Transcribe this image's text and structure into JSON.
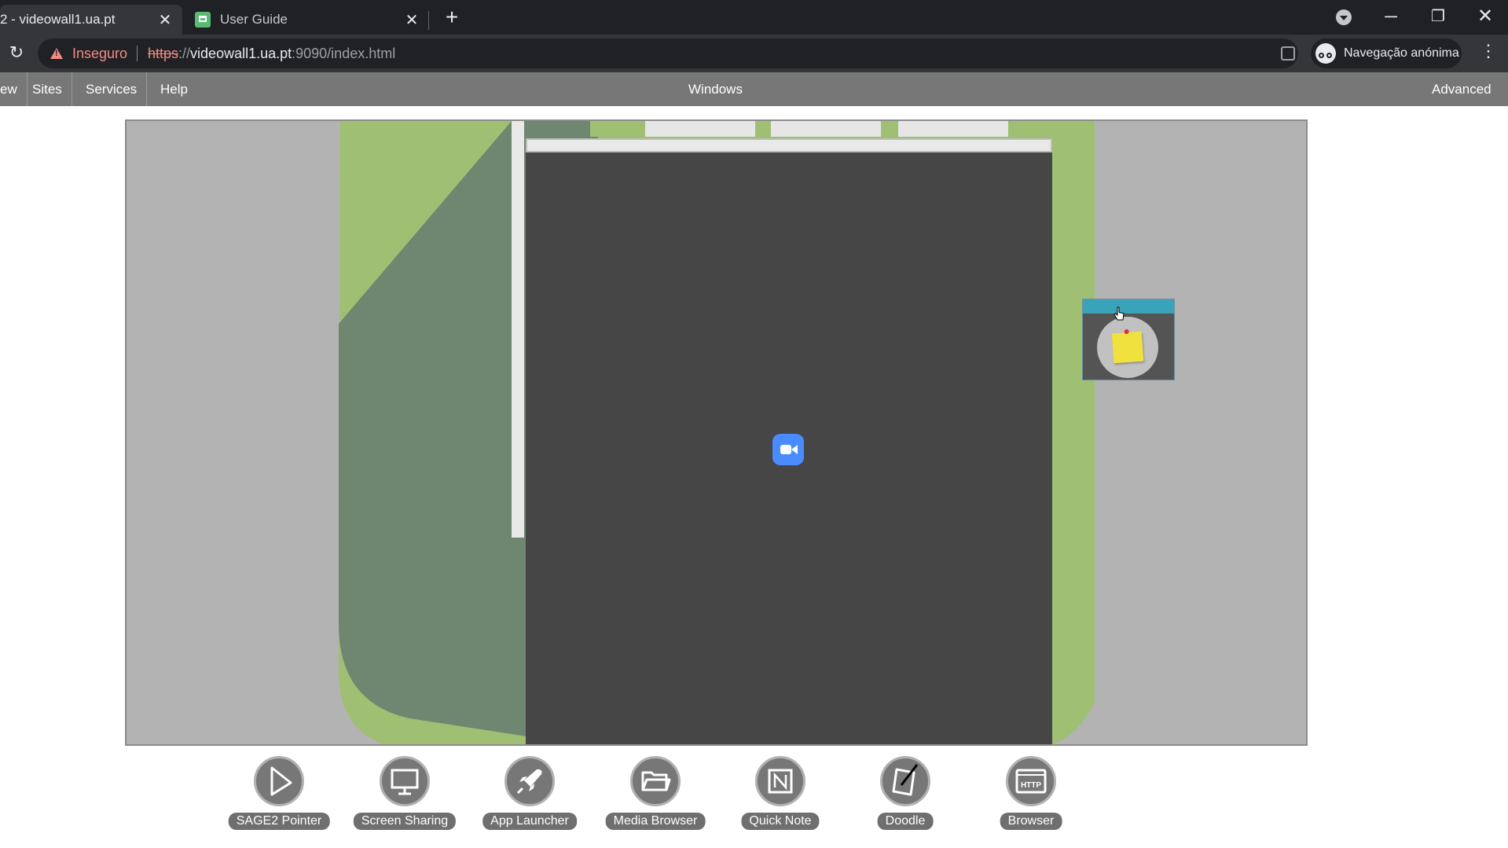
{
  "browser": {
    "tabs": [
      {
        "title": "2 - videowall1.ua.pt",
        "close": "✕"
      },
      {
        "title": "User Guide",
        "close": "✕"
      }
    ],
    "new_tab": "+",
    "window_controls": {
      "minimize": "─",
      "maximize": "❐",
      "close": "✕"
    },
    "reload": "↻",
    "security_label": "Inseguro",
    "url": {
      "scheme": "https",
      "sep": "://",
      "host": "videowall1.ua.pt",
      "rest": ":9090/index.html"
    },
    "bookmark": "☆",
    "incognito_label": "Navegação anónima",
    "menu": "⋮",
    "colors": {
      "tabbar": "#202124",
      "toolbar": "#35363a",
      "insecure": "#f28b82"
    }
  },
  "menubar": {
    "items": [
      "ew",
      "Sites",
      "Services",
      "Help"
    ],
    "center": "Windows",
    "right": "Advanced"
  },
  "wall": {
    "background": "#b3b3b3",
    "app_icon": "zoom-video-icon",
    "note_icon": "sticky-note-icon"
  },
  "launcher": [
    {
      "label": "SAGE2 Pointer",
      "icon": "pointer-arrow-icon"
    },
    {
      "label": "Screen Sharing",
      "icon": "monitor-icon"
    },
    {
      "label": "App Launcher",
      "icon": "rocket-icon"
    },
    {
      "label": "Media Browser",
      "icon": "folder-icon"
    },
    {
      "label": "Quick Note",
      "icon": "note-icon"
    },
    {
      "label": "Doodle",
      "icon": "pencil-icon"
    },
    {
      "label": "Browser",
      "icon": "http-browser-icon"
    }
  ]
}
